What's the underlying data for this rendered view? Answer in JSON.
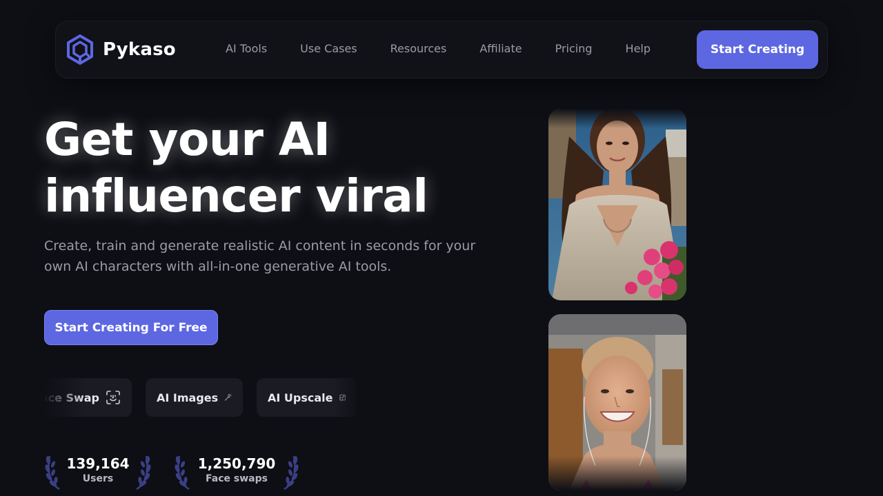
{
  "brand": {
    "name": "Pykaso",
    "accent": "#5d67e2",
    "logo_icon": "pykaso-hexagon-logo"
  },
  "nav": {
    "links": [
      "AI Tools",
      "Use Cases",
      "Resources",
      "Affiliate",
      "Pricing",
      "Help"
    ],
    "cta": "Start Creating"
  },
  "hero": {
    "title_line1": "Get your AI",
    "title_line2": "influencer viral",
    "subtitle": "Create, train and generate realistic AI content in seconds for your own AI characters with all-in-one generative AI tools.",
    "cta": "Start Creating For Free"
  },
  "tools": [
    {
      "label": "Face Swap",
      "icon": "face-scan-icon"
    },
    {
      "label": "AI Images",
      "icon": "magic-wand-icon"
    },
    {
      "label": "AI Upscale",
      "icon": "upscale-icon"
    }
  ],
  "stats": [
    {
      "value": "139,164",
      "label": "Users"
    },
    {
      "value": "1,250,790",
      "label": "Face swaps"
    }
  ],
  "gallery": [
    {
      "image": "woman-blouse-roses-photo"
    },
    {
      "image": "smiling-woman-selfie-photo"
    }
  ]
}
